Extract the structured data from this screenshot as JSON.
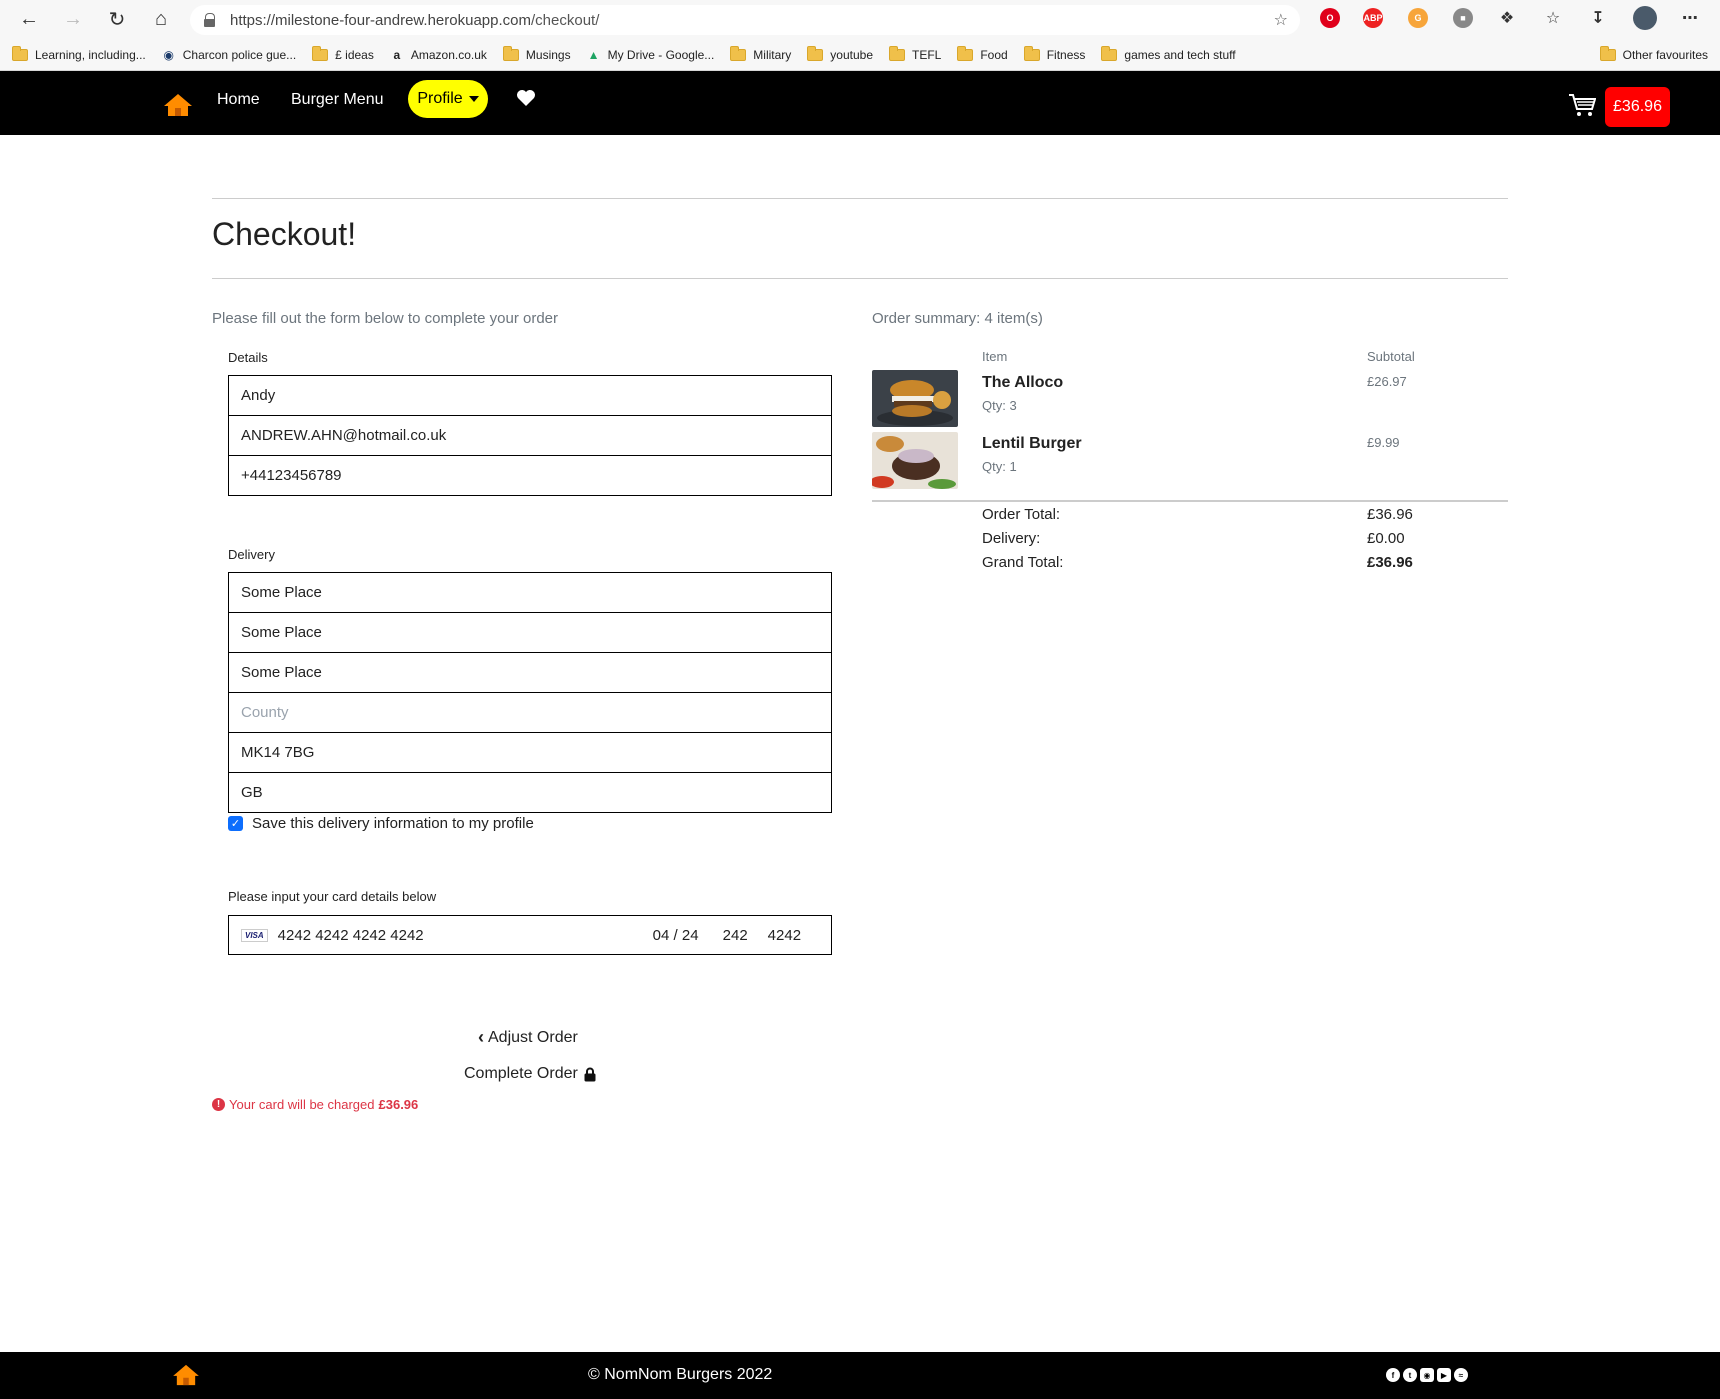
{
  "browser": {
    "url_host": "https://milestone-four-andrew.herokuapp.com",
    "url_path": "/checkout/",
    "bookmarks": [
      {
        "label": "Learning, including...",
        "icon": "folder"
      },
      {
        "label": "Charcon police gue...",
        "icon": "eye"
      },
      {
        "label": "£ ideas",
        "icon": "folder"
      },
      {
        "label": "Amazon.co.uk",
        "icon": "amazon"
      },
      {
        "label": "Musings",
        "icon": "folder"
      },
      {
        "label": "My Drive - Google...",
        "icon": "drive"
      },
      {
        "label": "Military",
        "icon": "folder"
      },
      {
        "label": "youtube",
        "icon": "folder"
      },
      {
        "label": "TEFL",
        "icon": "folder"
      },
      {
        "label": "Food",
        "icon": "folder"
      },
      {
        "label": "Fitness",
        "icon": "folder"
      },
      {
        "label": "games and tech stuff",
        "icon": "folder"
      }
    ],
    "other_favourites": "Other favourites"
  },
  "nav": {
    "home": "Home",
    "burger_menu": "Burger Menu",
    "profile": "Profile",
    "cart_total": "£36.96"
  },
  "page": {
    "title": "Checkout!",
    "intro": "Please fill out the form below to complete your order"
  },
  "form": {
    "details_label": "Details",
    "full_name": "Andy",
    "email": "ANDREW.AHN@hotmail.co.uk",
    "phone": "+44123456789",
    "delivery_label": "Delivery",
    "street1": "Some Place",
    "street2": "Some Place",
    "town": "Some Place",
    "county_placeholder": "County",
    "postcode": "MK14 7BG",
    "country": "GB",
    "save_label": "Save this delivery information to my profile",
    "card_label": "Please input your card details below",
    "card_brand": "VISA",
    "card_number": "4242 4242 4242 4242",
    "card_expiry": "04 / 24",
    "card_cvc": "242",
    "card_zip": "4242",
    "adjust_order": "Adjust Order",
    "complete_order": "Complete Order",
    "charge_text": "Your card will be charged",
    "charge_amount": "£36.96"
  },
  "summary": {
    "title": "Order summary: 4 item(s)",
    "col_item": "Item",
    "col_subtotal": "Subtotal",
    "items": [
      {
        "name": "The Alloco",
        "qty": "Qty: 3",
        "subtotal": "£26.97"
      },
      {
        "name": "Lentil Burger",
        "qty": "Qty: 1",
        "subtotal": "£9.99"
      }
    ],
    "order_total_label": "Order Total:",
    "order_total": "£36.96",
    "delivery_label": "Delivery:",
    "delivery": "£0.00",
    "grand_total_label": "Grand Total:",
    "grand_total": "£36.96"
  },
  "footer": {
    "copyright": "© NomNom Burgers 2022"
  },
  "colors": {
    "accent_yellow": "#ffff00",
    "cart_red": "#ff0000",
    "error_red": "#dc3545",
    "checkbox_blue": "#0d6efd"
  }
}
